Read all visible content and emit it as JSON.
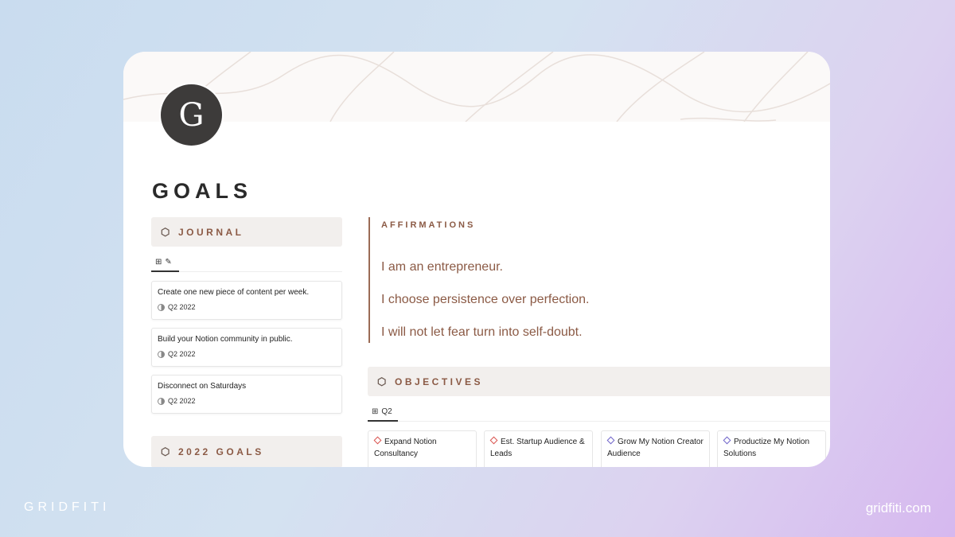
{
  "page": {
    "avatar_letter": "G",
    "title": "GOALS"
  },
  "journal": {
    "header": "JOURNAL",
    "items": [
      {
        "text": "Create one new piece of content per week.",
        "date": "Q2 2022"
      },
      {
        "text": "Build your Notion community in public.",
        "date": "Q2 2022"
      },
      {
        "text": "Disconnect on Saturdays",
        "date": "Q2 2022"
      }
    ]
  },
  "goals2022": {
    "header": "2022 GOALS"
  },
  "affirmations": {
    "label": "AFFIRMATIONS",
    "lines": [
      "I am an entrepreneur.",
      "I choose persistence over perfection.",
      "I will not let fear turn into self-doubt."
    ]
  },
  "objectives": {
    "header": "OBJECTIVES",
    "tab": "Q2",
    "cards": [
      {
        "title": "Expand Notion Consultancy",
        "color": "#d9534f"
      },
      {
        "title": "Est. Startup Audience & Leads",
        "color": "#d9534f"
      },
      {
        "title": "Grow My Notion Creator Audience",
        "color": "#6f63c9"
      },
      {
        "title": "Productize My Notion Solutions",
        "color": "#6f63c9"
      }
    ]
  },
  "branding": {
    "left": "GRIDFITI",
    "right": "gridfiti.com"
  },
  "colors": {
    "accent": "#8b5a45",
    "header_bg": "#f2efed"
  }
}
